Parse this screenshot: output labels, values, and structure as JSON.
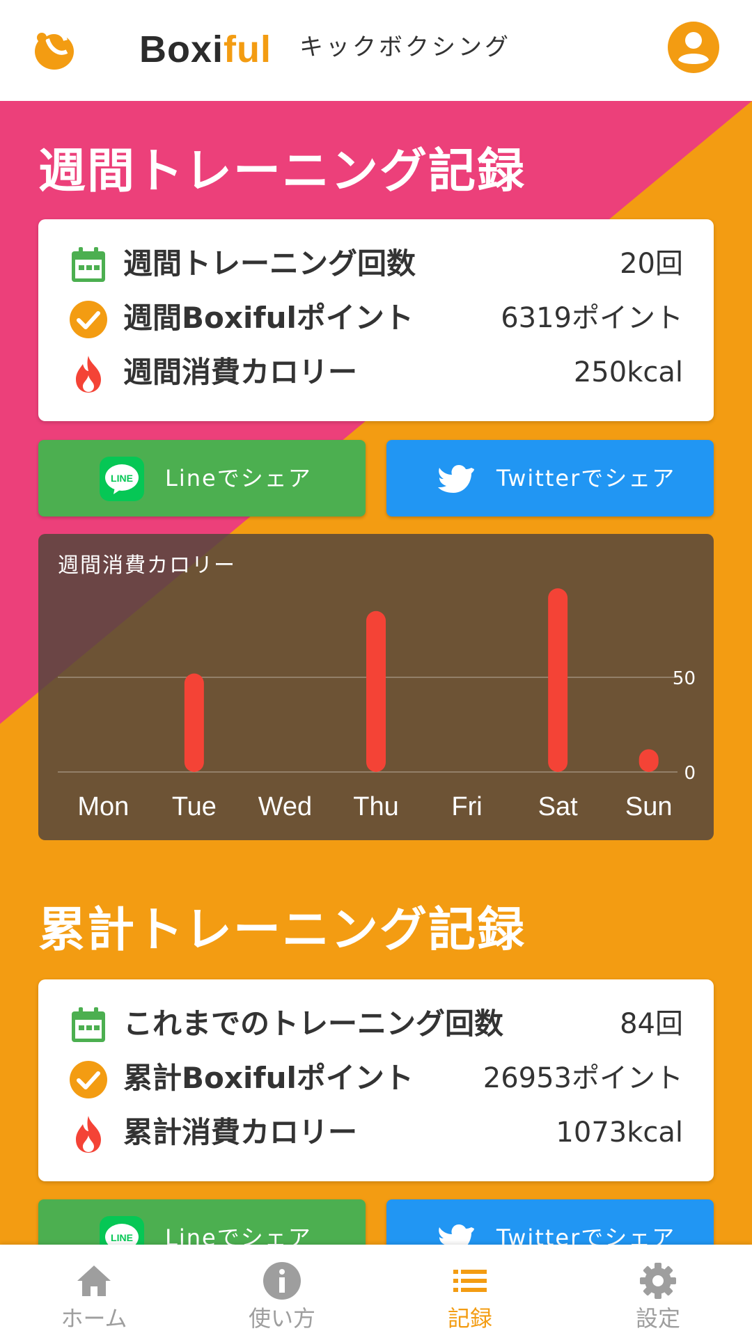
{
  "app": {
    "brand_main": "Boxi",
    "brand_accent": "ful",
    "sport": "キックボクシング"
  },
  "colors": {
    "orange": "#f39c12",
    "pink": "#ec407a",
    "line_green": "#4caf50",
    "twitter_blue": "#2196f3",
    "bar_red": "#f44336",
    "calendar_green": "#4caf50",
    "fire_red": "#f44336"
  },
  "weekly": {
    "title": "週間トレーニング記録",
    "stats": [
      {
        "icon": "calendar-icon",
        "label": "週間トレーニング回数",
        "value": "20回"
      },
      {
        "icon": "check-circle-icon",
        "label": "週間Boxifulポイント",
        "value": "6319ポイント"
      },
      {
        "icon": "fire-icon",
        "label": "週間消費カロリー",
        "value": "250kcal"
      }
    ],
    "share_line": "Lineでシェア",
    "share_twitter": "Twitterでシェア"
  },
  "chart_data": {
    "type": "bar",
    "title": "週間消費カロリー",
    "categories": [
      "Mon",
      "Tue",
      "Wed",
      "Thu",
      "Fri",
      "Sat",
      "Sun"
    ],
    "values": [
      0,
      52,
      0,
      85,
      0,
      97,
      12
    ],
    "ylim": [
      0,
      100
    ],
    "yticks": [
      0,
      50
    ],
    "grid": true
  },
  "total": {
    "title": "累計トレーニング記録",
    "stats": [
      {
        "icon": "calendar-icon",
        "label": "これまでのトレーニング回数",
        "value": "84回"
      },
      {
        "icon": "check-circle-icon",
        "label": "累計Boxifulポイント",
        "value": "26953ポイント"
      },
      {
        "icon": "fire-icon",
        "label": "累計消費カロリー",
        "value": "1073kcal"
      }
    ],
    "share_line": "Lineでシェア",
    "share_twitter": "Twitterでシェア"
  },
  "nav": {
    "items": [
      {
        "icon": "home-icon",
        "label": "ホーム",
        "active": false
      },
      {
        "icon": "info-icon",
        "label": "使い方",
        "active": false
      },
      {
        "icon": "list-icon",
        "label": "記録",
        "active": true
      },
      {
        "icon": "gear-icon",
        "label": "設定",
        "active": false
      }
    ]
  }
}
